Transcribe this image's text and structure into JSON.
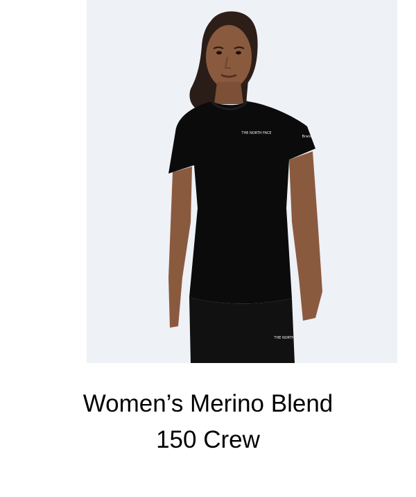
{
  "product": {
    "title_line_1": "Women’s Merino Blend",
    "title_line_2": "150 Crew",
    "image": {
      "logo_text": "THE NORTH FACE",
      "sleeve_text": "Brand",
      "legging_logo_text": "THE NORTH FACE"
    }
  },
  "colors": {
    "photo_background": "#eef1f6",
    "garment": "#0b0b0c",
    "skin": "#8a5a3f"
  }
}
